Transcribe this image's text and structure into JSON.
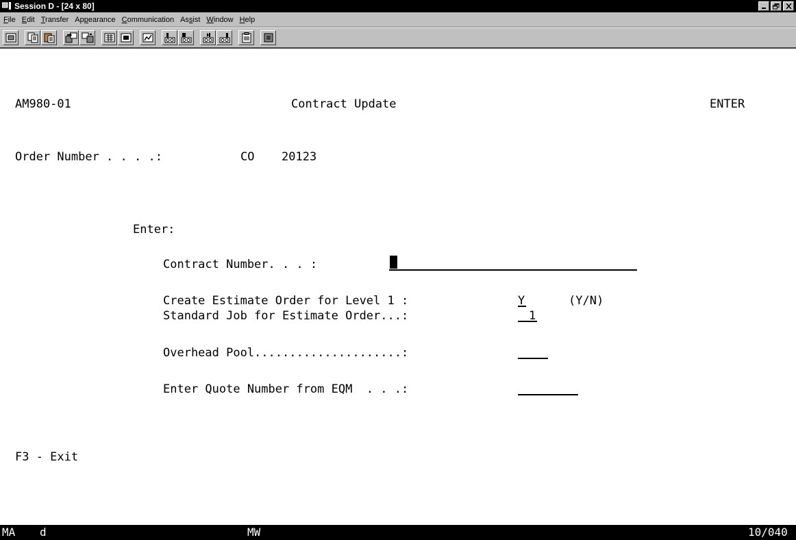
{
  "window": {
    "title": "Session D - [24 x 80]",
    "buttons": [
      "minimize",
      "maximize",
      "close"
    ]
  },
  "menu": {
    "items": [
      {
        "label": "File",
        "u": "F",
        "rest": "ile"
      },
      {
        "label": "Edit",
        "u": "E",
        "rest": "dit"
      },
      {
        "label": "Transfer",
        "u": "T",
        "rest": "ransfer"
      },
      {
        "label": "Appearance",
        "pre": "Ap",
        "u": "p",
        "rest": "earance"
      },
      {
        "label": "Communication",
        "u": "C",
        "rest": "ommunication"
      },
      {
        "label": "Assist",
        "pre": "As",
        "u": "s",
        "rest": "ist"
      },
      {
        "label": "Window",
        "u": "W",
        "rest": "indow"
      },
      {
        "label": "Help",
        "u": "H",
        "rest": "elp"
      }
    ]
  },
  "toolbar": {
    "icons": [
      "print-screen-icon",
      "copy-icon",
      "paste-icon",
      "send-file-icon",
      "receive-file-icon",
      "keyboard-map-icon",
      "display-setup-icon",
      "macro-icon",
      "start-record-icon",
      "stop-record-icon",
      "play-macro-icon",
      "macro-pause-icon",
      "clipboard-icon",
      "stop-icon"
    ]
  },
  "screen": {
    "program_id": "AM980-01",
    "screen_title": "Contract Update",
    "mode": "ENTER",
    "order_label": "Order Number . . . .:",
    "order_type": "CO",
    "order_number": "20123",
    "enter_label": "Enter:",
    "contract_label": "Contract Number. . . :",
    "contract_value": "",
    "estimate_label": "Create Estimate Order for Level 1 :",
    "estimate_value": "Y",
    "estimate_hint": "(Y/N)",
    "stdjob_label": "Standard Job for Estimate Order...:",
    "stdjob_value": "1",
    "overhead_label": "Overhead Pool.....................:",
    "overhead_value": "",
    "quote_label": "Enter Quote Number from EQM  . . .:",
    "quote_value": "",
    "f3_label": "F3 - Exit"
  },
  "status": {
    "indicator": "MA",
    "session_flag": "d",
    "mw": "MW",
    "cursor_pos": "10/040"
  }
}
